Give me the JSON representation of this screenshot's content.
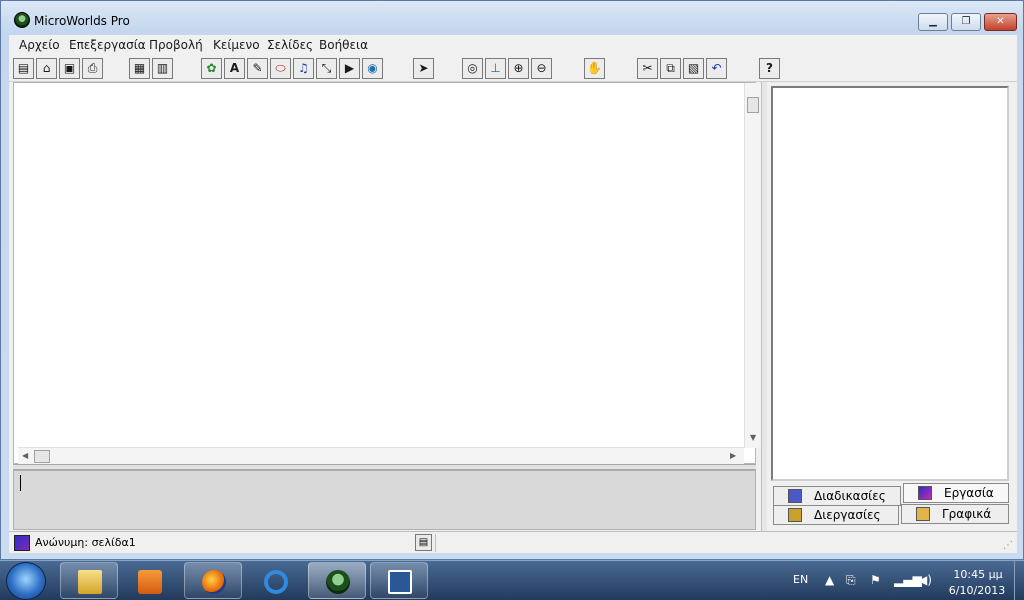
{
  "window": {
    "title": "MicroWorlds Pro",
    "controls": {
      "minimize": "▁",
      "maximize": "❐",
      "close": "✕"
    }
  },
  "menu": {
    "items": [
      "Αρχείο",
      "Επεξεργασία",
      "Προβολή",
      "Κείμενο",
      "Σελίδες",
      "Βοήθεια"
    ]
  },
  "toolbar": {
    "buttons": [
      {
        "icon": "new-project-icon",
        "glyph": "▤"
      },
      {
        "icon": "open-folder-icon",
        "glyph": "⌂"
      },
      {
        "icon": "save-icon",
        "glyph": "▣"
      },
      {
        "icon": "print-icon",
        "glyph": "⎙"
      },
      {
        "icon": "presentation-mode-icon",
        "glyph": "▦"
      },
      {
        "icon": "normal-mode-icon",
        "glyph": "▥"
      },
      {
        "icon": "turtle-icon",
        "glyph": "✿"
      },
      {
        "icon": "text-box-icon",
        "glyph": "A"
      },
      {
        "icon": "paint-icon",
        "glyph": "✎"
      },
      {
        "icon": "button-icon",
        "glyph": "⬭"
      },
      {
        "icon": "music-icon",
        "glyph": "♫"
      },
      {
        "icon": "slider-icon",
        "glyph": "⤡"
      },
      {
        "icon": "movie-icon",
        "glyph": "▶"
      },
      {
        "icon": "globe-icon",
        "glyph": "◉"
      },
      {
        "icon": "pointer-icon",
        "glyph": "➤"
      },
      {
        "icon": "eye-icon",
        "glyph": "◎"
      },
      {
        "icon": "stamp-icon",
        "glyph": "⊥"
      },
      {
        "icon": "zoom-in-icon",
        "glyph": "⊕"
      },
      {
        "icon": "zoom-out-icon",
        "glyph": "⊖"
      },
      {
        "icon": "stop-icon",
        "glyph": "✋"
      },
      {
        "icon": "cut-icon",
        "glyph": "✂"
      },
      {
        "icon": "copy-icon",
        "glyph": "⧉"
      },
      {
        "icon": "paste-icon",
        "glyph": "▧"
      },
      {
        "icon": "undo-icon",
        "glyph": "↶"
      },
      {
        "icon": "help-icon",
        "glyph": "?"
      }
    ]
  },
  "tabs": {
    "procedures": "Διαδικασίες",
    "project": "Εργασία",
    "processes": "Διεργασίες",
    "graphics": "Γραφικά"
  },
  "status": {
    "text": "Ανώνυμη:  σελίδα1"
  },
  "taskbar": {
    "apps": [
      "explorer-icon",
      "media-player-icon",
      "firefox-icon",
      "internet-explorer-icon",
      "microworlds-icon",
      "word-icon"
    ],
    "language": "EN",
    "time": "10:45 μμ",
    "date": "6/10/2013"
  },
  "colors": {
    "accent": "#2e6fc5",
    "close_button": "#c0412c",
    "firefox": "#e66000",
    "word": "#2b5797"
  }
}
